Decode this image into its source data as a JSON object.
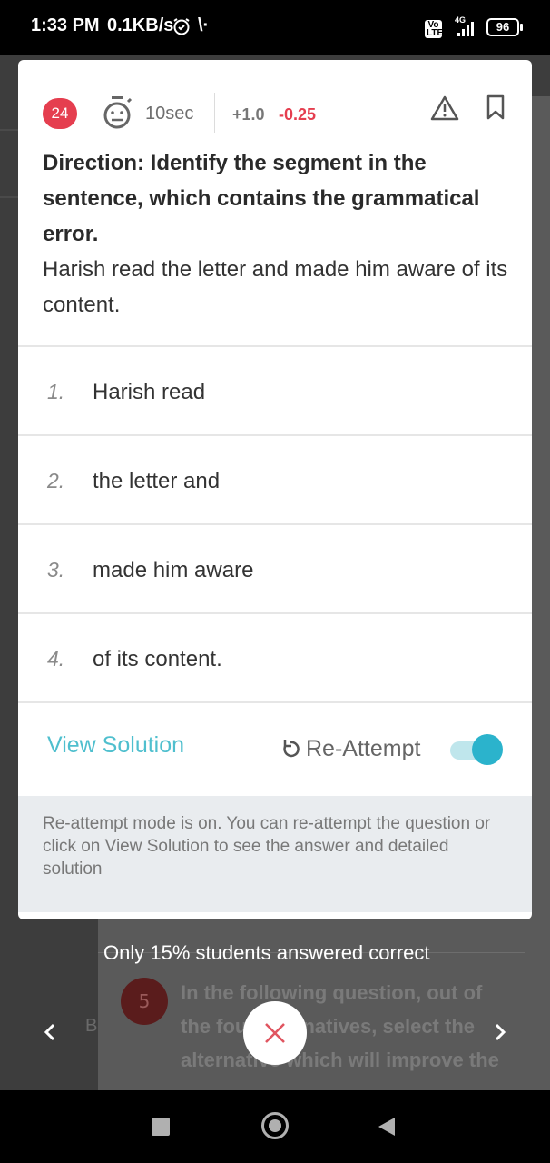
{
  "status_bar": {
    "time": "1:33 PM",
    "speed": "0.1KB/s",
    "network": "4G",
    "volte": "Vo LTE",
    "battery": "96"
  },
  "question": {
    "number": "24",
    "timer": "10sec",
    "marks_positive": "+1.0",
    "marks_negative": "-0.25",
    "direction": "Direction: Identify the segment in the sentence, which contains the grammatical error.",
    "sentence": "Harish read the letter and made him aware of its content.",
    "options": [
      {
        "num": "1.",
        "text": "Harish read"
      },
      {
        "num": "2.",
        "text": "the letter and"
      },
      {
        "num": "3.",
        "text": "made him aware"
      },
      {
        "num": "4.",
        "text": "of its content."
      }
    ]
  },
  "actions": {
    "view_solution": "View Solution",
    "reattempt": "Re-Attempt",
    "reattempt_enabled": true
  },
  "info": {
    "message": "Re-attempt mode is on. You can re-attempt the question or click on View Solution to see the answer and detailed solution"
  },
  "background": {
    "stats": "Only 15% students answered correct",
    "next_question_number": "5",
    "next_question_text": "In the following question, out of the four alternatives, select the alternative which will improve the",
    "side_letter": "B"
  },
  "colors": {
    "accent_red": "#e53e4f",
    "accent_teal": "#4fbfce",
    "toggle_on": "#2bb3cc"
  }
}
